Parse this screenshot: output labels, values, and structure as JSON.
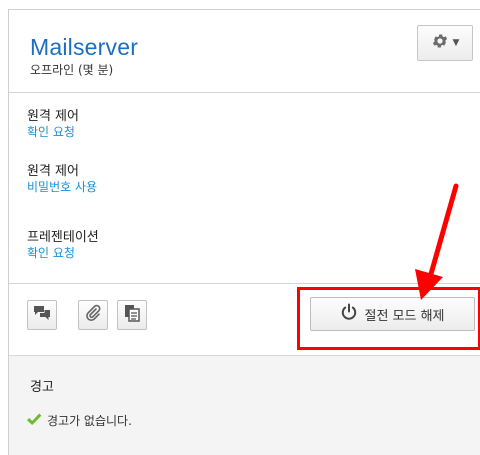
{
  "device": {
    "name": "Mailserver",
    "status": "오프라인 (몇 분)"
  },
  "settings": [
    {
      "label": "원격 제어",
      "value": "확인 요청"
    },
    {
      "label": "원격 제어",
      "value": "비밀번호 사용"
    },
    {
      "label": "프레젠테이션",
      "value": "확인 요청"
    }
  ],
  "actions": {
    "wake_label": "절전 모드 해제"
  },
  "alerts": {
    "title": "경고",
    "message": "경고가 없습니다."
  },
  "colors": {
    "title": "#1c6fbf",
    "link": "#1a8fd9",
    "annotation": "#ff0000",
    "check": "#6dbb2f"
  },
  "icons": [
    "gear-icon",
    "chat-icon",
    "paperclip-icon",
    "clipboard-icon",
    "power-icon",
    "checkmark-icon"
  ]
}
